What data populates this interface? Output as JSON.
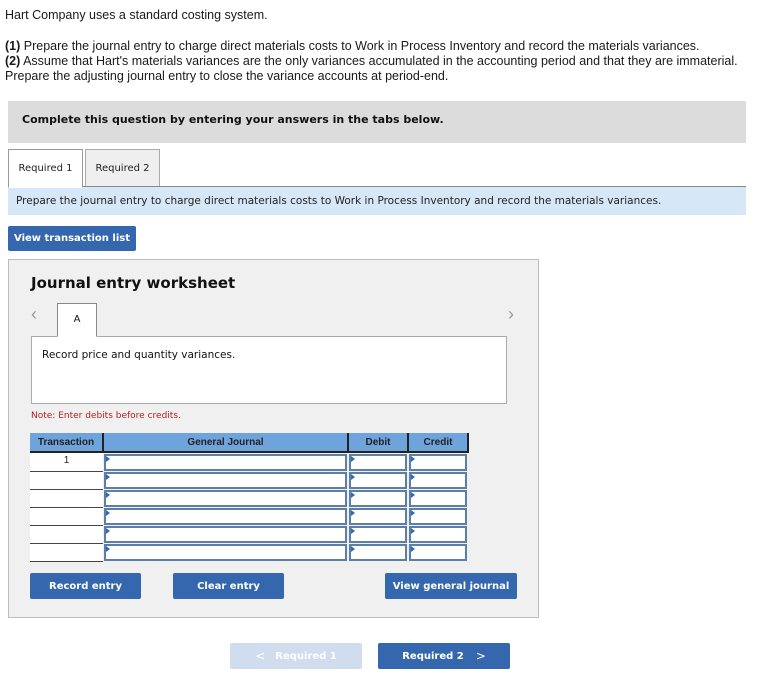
{
  "intro": {
    "line1": "Hart Company uses a standard costing system.",
    "req1_num": "(1)",
    "req1_text": " Prepare the journal entry to charge direct materials costs to Work in Process Inventory and record the materials variances.",
    "req2_num": "(2)",
    "req2_text": " Assume that Hart's materials variances are the only variances accumulated in the accounting period and that they are immaterial.",
    "req2_cont": "Prepare the adjusting journal entry to close the variance accounts at period-end."
  },
  "banner": "Complete this question by entering your answers in the tabs below.",
  "tabs": [
    {
      "label": "Required 1",
      "active": true
    },
    {
      "label": "Required 2",
      "active": false
    }
  ],
  "instruction": "Prepare the journal entry to charge direct materials costs to Work in Process Inventory and record the materials variances.",
  "view_transaction_list": "View transaction list",
  "worksheet": {
    "title": "Journal entry worksheet",
    "prev_icon": "‹",
    "next_icon": "›",
    "entry_tab": "A",
    "description": "Record price and quantity variances.",
    "note": "Note: Enter debits before credits.",
    "columns": [
      "Transaction",
      "General Journal",
      "Debit",
      "Credit"
    ],
    "rows": [
      {
        "transaction": "1",
        "account": "",
        "debit": "",
        "credit": ""
      },
      {
        "transaction": "",
        "account": "",
        "debit": "",
        "credit": ""
      },
      {
        "transaction": "",
        "account": "",
        "debit": "",
        "credit": ""
      },
      {
        "transaction": "",
        "account": "",
        "debit": "",
        "credit": ""
      },
      {
        "transaction": "",
        "account": "",
        "debit": "",
        "credit": ""
      },
      {
        "transaction": "",
        "account": "",
        "debit": "",
        "credit": ""
      }
    ],
    "record_entry": "Record entry",
    "clear_entry": "Clear entry",
    "view_general_journal": "View general journal"
  },
  "nav": {
    "prev_label": "Required 1",
    "prev_icon": "<",
    "next_label": "Required 2",
    "next_icon": ">"
  },
  "colors": {
    "button_blue": "#3567ae",
    "header_blue": "#6fa3dc",
    "instruction_bg": "#d6e8f7",
    "note_red": "#b22222",
    "disabled_button": "#d0ddee"
  }
}
